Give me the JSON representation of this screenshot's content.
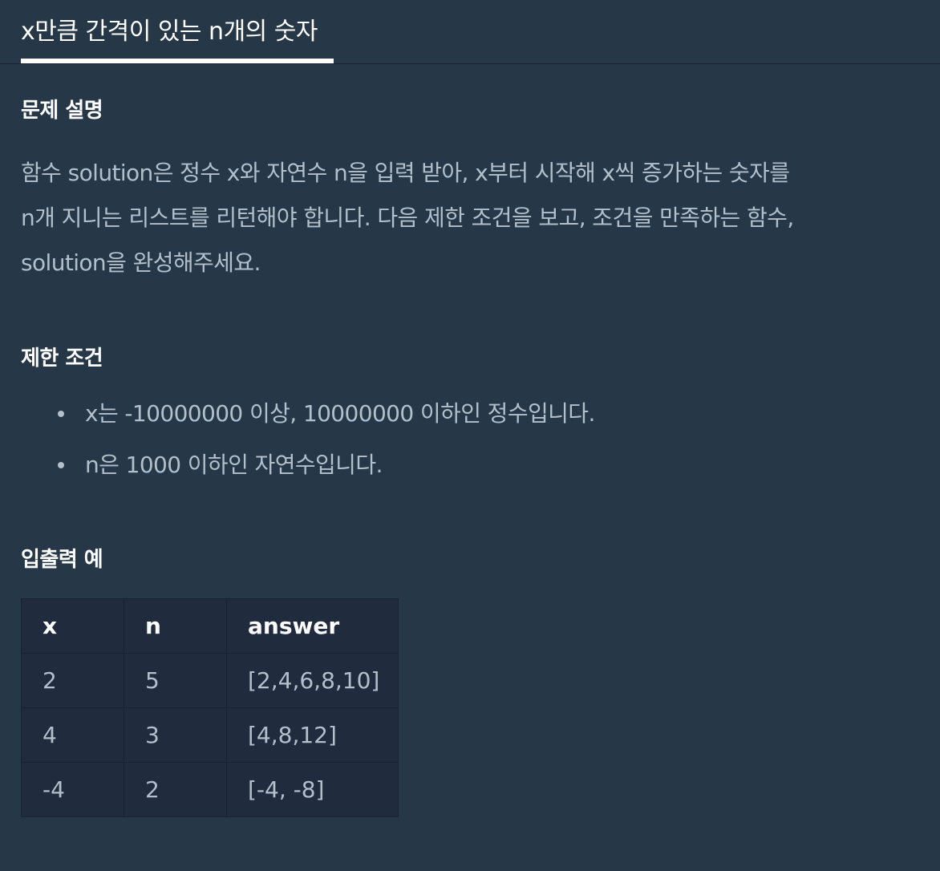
{
  "tab": {
    "title": "x만큼 간격이 있는 n개의 숫자"
  },
  "description": {
    "heading": "문제 설명",
    "lines": [
      "함수 solution은 정수 x와 자연수 n을 입력 받아, x부터 시작해 x씩 증가하는 숫자를",
      "n개 지니는 리스트를 리턴해야 합니다. 다음 제한 조건을 보고, 조건을 만족하는 함수,",
      "solution을 완성해주세요."
    ]
  },
  "limits": {
    "heading": "제한 조건",
    "items": [
      "x는 -10000000 이상, 10000000 이하인 정수입니다.",
      "n은 1000 이하인 자연수입니다."
    ]
  },
  "examples": {
    "heading": "입출력 예",
    "columns": [
      "x",
      "n",
      "answer"
    ],
    "rows": [
      [
        "2",
        "5",
        "[2,4,6,8,10]"
      ],
      [
        "4",
        "3",
        "[4,8,12]"
      ],
      [
        "-4",
        "2",
        "[-4, -8]"
      ]
    ]
  },
  "colors": {
    "background": "#263747",
    "table_background": "#202b3d",
    "border": "#172334",
    "text": "#b2c0cc",
    "heading": "#ffffff"
  }
}
